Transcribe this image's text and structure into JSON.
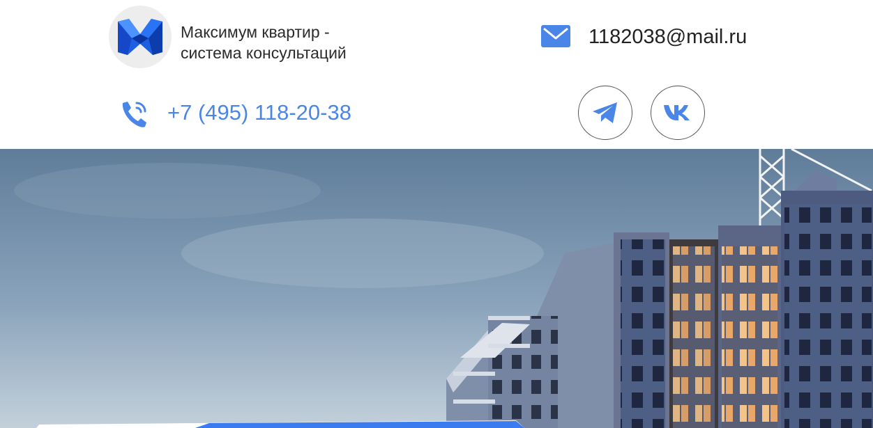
{
  "brand": {
    "line1": "Максимум квартир -",
    "line2": "система консультаций",
    "logo_icon": "maximum-m-logo",
    "logo_colors": {
      "light": "#2f7cff",
      "dark": "#0a3fb8"
    }
  },
  "contacts": {
    "email": "1182038@mail.ru",
    "email_icon": "envelope-icon",
    "phone": "+7 (495) 118-20-38",
    "phone_icon": "phone-ringing-icon"
  },
  "social": [
    {
      "name": "Telegram",
      "icon": "telegram-icon"
    },
    {
      "name": "VK",
      "icon": "vk-icon"
    }
  ],
  "hero": {
    "image": "residential-building-under-construction-at-dusk",
    "accent_color": "#3b7bf0"
  },
  "colors": {
    "accent": "#4a86e8",
    "text": "#222222"
  }
}
